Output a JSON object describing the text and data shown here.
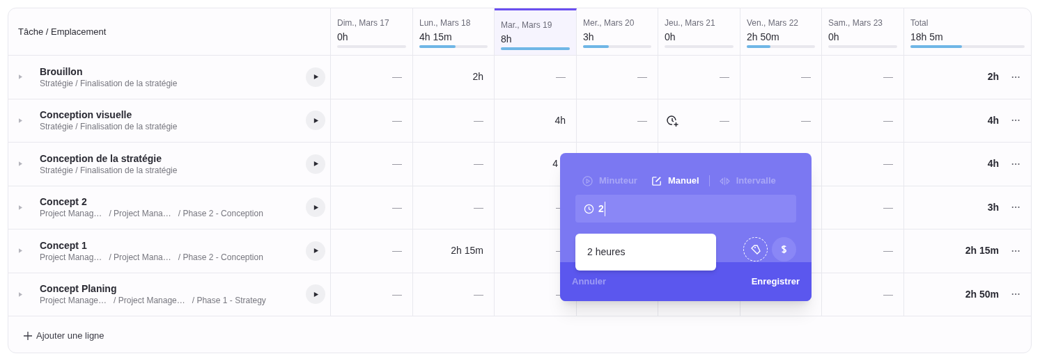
{
  "table": {
    "task_header": "Tâche / Emplacement",
    "days": [
      {
        "label": "Dim., Mars 17",
        "total": "0h",
        "level": 0,
        "selected": false
      },
      {
        "label": "Lun., Mars 18",
        "total": "4h 15m",
        "level": 0.53,
        "selected": false
      },
      {
        "label": "Mar., Mars 19",
        "total": "8h",
        "level": 1,
        "selected": true
      },
      {
        "label": "Mer., Mars 20",
        "total": "3h",
        "level": 0.375,
        "selected": false
      },
      {
        "label": "Jeu., Mars 21",
        "total": "0h",
        "level": 0,
        "selected": false
      },
      {
        "label": "Ven., Mars 22",
        "total": "2h 50m",
        "level": 0.35,
        "selected": false
      },
      {
        "label": "Sam., Mars 23",
        "total": "0h",
        "level": 0,
        "selected": false
      }
    ],
    "total_header": {
      "label": "Total",
      "total": "18h 5m",
      "level": 0.45
    },
    "rows": [
      {
        "name": "Brouillon",
        "path": [
          "Stratégie / Finalisation de la stratégie"
        ],
        "cells": [
          "—",
          "2h",
          "—",
          "—",
          "—",
          "—",
          "—"
        ],
        "total": "2h"
      },
      {
        "name": "Conception visuelle",
        "path": [
          "Stratégie / Finalisation de la stratégie"
        ],
        "cells": [
          "—",
          "—",
          "4h",
          "—",
          {
            "text": "—",
            "add_time": true
          },
          "—",
          "—"
        ],
        "total": "4h"
      },
      {
        "name": "Conception de la stratégie",
        "path": [
          "Stratégie / Finalisation de la stratégie"
        ],
        "cells": [
          "—",
          "—",
          {
            "text": "4",
            "cut": true
          },
          null,
          null,
          null,
          "—"
        ],
        "total": "4h"
      },
      {
        "name": "Concept 2",
        "path": [
          "Project Manag…",
          "/ Project Mana…",
          "/ Phase 2 - Conception"
        ],
        "cells": [
          "—",
          "—",
          "—",
          null,
          null,
          null,
          "—"
        ],
        "total": "3h"
      },
      {
        "name": "Concept 1",
        "path": [
          "Project Manag…",
          "/ Project Mana…",
          "/ Phase 2 - Conception"
        ],
        "cells": [
          "—",
          "2h 15m",
          "—",
          null,
          null,
          null,
          "—"
        ],
        "total": "2h 15m"
      },
      {
        "name": "Concept Planing",
        "path": [
          "Project Manage…",
          "/ Project Manage…",
          "/ Phase 1 - Strategy"
        ],
        "cells": [
          "—",
          "—",
          "—",
          null,
          null,
          null,
          "—"
        ],
        "total": "2h 50m"
      }
    ],
    "add_row": "Ajouter une ligne"
  },
  "popup": {
    "tabs": [
      {
        "label": "Minuteur",
        "kind": "timer",
        "selected": false
      },
      {
        "label": "Manuel",
        "kind": "manual",
        "selected": true
      },
      {
        "label": "Intervalle",
        "kind": "range",
        "selected": false
      }
    ],
    "input_value": "2",
    "suggestion": "2 heures",
    "cancel": "Annuler",
    "save": "Enregistrer"
  }
}
